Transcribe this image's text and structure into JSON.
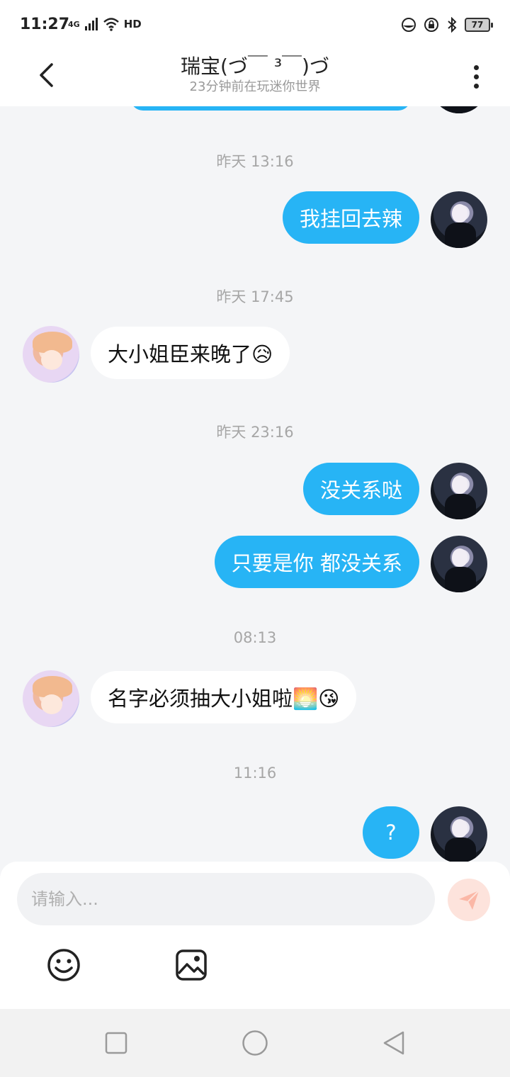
{
  "status_bar": {
    "time": "11:27",
    "network": "4G",
    "hd": "HD",
    "battery": "77"
  },
  "header": {
    "title": "瑞宝(づ￣ ³￣)づ",
    "subtitle": "23分钟前在玩迷你世界"
  },
  "messages": [
    {
      "type": "time",
      "text": "昨天 13:16"
    },
    {
      "type": "out",
      "text": "我挂回去辣"
    },
    {
      "type": "time",
      "text": "昨天 17:45"
    },
    {
      "type": "in",
      "text": "大小姐臣来晚了😥"
    },
    {
      "type": "time",
      "text": "昨天 23:16"
    },
    {
      "type": "out",
      "text": "没关系哒"
    },
    {
      "type": "out",
      "text": "只要是你 都没关系"
    },
    {
      "type": "time",
      "text": "08:13"
    },
    {
      "type": "in",
      "text": "名字必须抽大小姐啦🌅😘"
    },
    {
      "type": "time",
      "text": "11:16"
    },
    {
      "type": "out",
      "text": "?"
    }
  ],
  "composer": {
    "placeholder": "请输入..."
  },
  "icons": {
    "back": "back-chevron-icon",
    "more": "more-vertical-icon",
    "send": "send-plane-icon",
    "emoji": "emoji-smile-icon",
    "image": "image-picture-icon"
  },
  "colors": {
    "outgoing_bubble": "#27b4f5",
    "incoming_bubble": "#ffffff",
    "chat_background": "#f4f5f7",
    "send_button": "#fde3dc"
  }
}
